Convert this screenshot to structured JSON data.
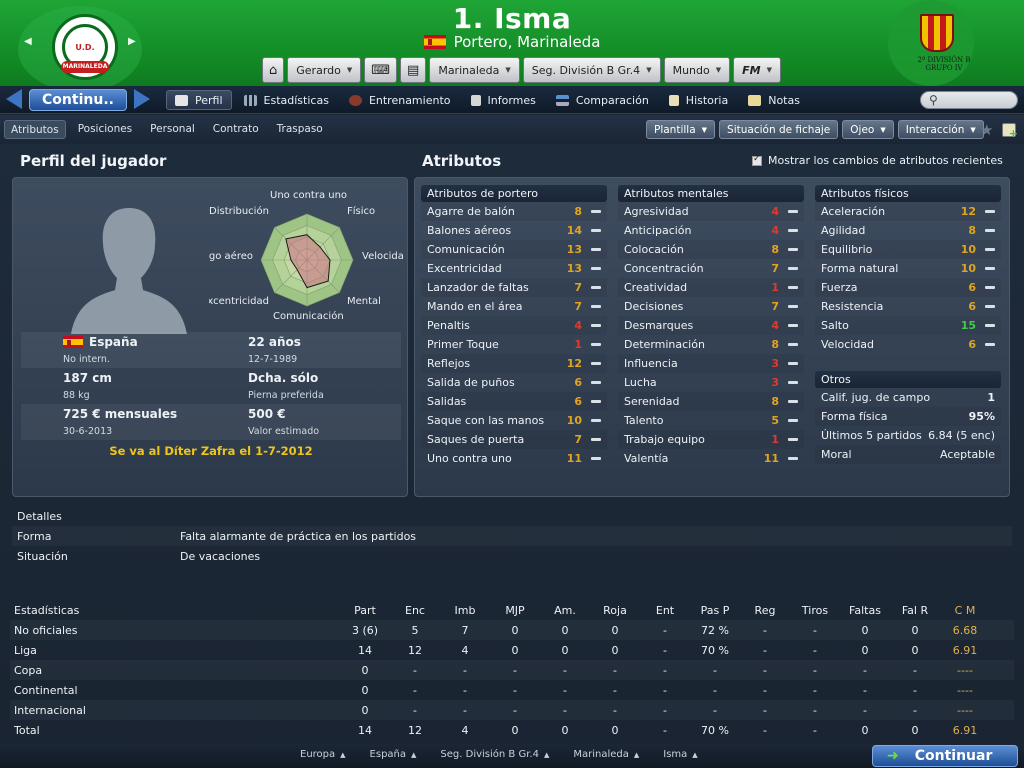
{
  "header": {
    "player_title": "1. Isma",
    "player_subtitle": "Portero, Marinaleda",
    "club_logo_text": "MARINALEDA",
    "club_logo_top": "U.D.",
    "league_logo_text": "2ª DIVISIÓN B GRUPO IV",
    "buttons": {
      "manager": "Gerardo",
      "club": "Marinaleda",
      "competition": "Seg. División B Gr.4",
      "world": "Mundo",
      "fm": "FM"
    }
  },
  "nav": {
    "continue_label": "Continu..",
    "tabs": [
      "Perfil",
      "Estadísticas",
      "Entrenamiento",
      "Informes",
      "Comparación",
      "Historia",
      "Notas"
    ],
    "active_tab": "Perfil"
  },
  "subnav": {
    "tabs": [
      "Atributos",
      "Posiciones",
      "Personal",
      "Contrato",
      "Traspaso"
    ],
    "active_tab": "Atributos",
    "buttons": {
      "plantilla": "Plantilla",
      "transfer_status": "Situación de fichaje",
      "scout": "Ojeo",
      "interaction": "Interacción"
    }
  },
  "profile": {
    "heading": "Perfil del jugador",
    "radar_labels": {
      "top": "Uno contra uno",
      "tl": "Distribución",
      "tr": "Físico",
      "l": "Juego aéreo",
      "r": "Velocidad",
      "bl": "Excentricidad",
      "br": "Mental",
      "bottom": "Comunicación"
    },
    "radar_values": [
      11,
      8,
      10,
      13,
      12,
      6,
      7,
      13
    ],
    "nationality": "España",
    "intl": "No intern.",
    "age": "22 años",
    "dob": "12-7-1989",
    "height": "187 cm",
    "weight": "88 kg",
    "foot": "Dcha. sólo",
    "foot_label": "Pierna preferida",
    "wage": "725 € mensuales",
    "contract_end": "30-6-2013",
    "value": "500 €",
    "value_label": "Valor estimado",
    "leaving_note": "Se va al Díter Zafra el 1-7-2012"
  },
  "attributes": {
    "heading": "Atributos",
    "show_changes_label": "Mostrar los cambios de atributos recientes",
    "goalkeeping": {
      "title": "Atributos de portero",
      "items": [
        {
          "name": "Agarre de balón",
          "value": "8",
          "color": "y"
        },
        {
          "name": "Balones aéreos",
          "value": "14",
          "color": "y"
        },
        {
          "name": "Comunicación",
          "value": "13",
          "color": "y"
        },
        {
          "name": "Excentricidad",
          "value": "13",
          "color": "y"
        },
        {
          "name": "Lanzador de faltas",
          "value": "7",
          "color": "y"
        },
        {
          "name": "Mando en el área",
          "value": "7",
          "color": "y"
        },
        {
          "name": "Penaltis",
          "value": "4",
          "color": "r"
        },
        {
          "name": "Primer Toque",
          "value": "1",
          "color": "r"
        },
        {
          "name": "Reflejos",
          "value": "12",
          "color": "y"
        },
        {
          "name": "Salida de puños",
          "value": "6",
          "color": "y"
        },
        {
          "name": "Salidas",
          "value": "6",
          "color": "y"
        },
        {
          "name": "Saque con las manos",
          "value": "10",
          "color": "y"
        },
        {
          "name": "Saques de puerta",
          "value": "7",
          "color": "y"
        },
        {
          "name": "Uno contra uno",
          "value": "11",
          "color": "y"
        }
      ]
    },
    "mental": {
      "title": "Atributos mentales",
      "items": [
        {
          "name": "Agresividad",
          "value": "4",
          "color": "r"
        },
        {
          "name": "Anticipación",
          "value": "4",
          "color": "r"
        },
        {
          "name": "Colocación",
          "value": "8",
          "color": "y"
        },
        {
          "name": "Concentración",
          "value": "7",
          "color": "y"
        },
        {
          "name": "Creatividad",
          "value": "1",
          "color": "r"
        },
        {
          "name": "Decisiones",
          "value": "7",
          "color": "y"
        },
        {
          "name": "Desmarques",
          "value": "4",
          "color": "r"
        },
        {
          "name": "Determinación",
          "value": "8",
          "color": "y"
        },
        {
          "name": "Influencia",
          "value": "3",
          "color": "r"
        },
        {
          "name": "Lucha",
          "value": "3",
          "color": "r"
        },
        {
          "name": "Serenidad",
          "value": "8",
          "color": "y"
        },
        {
          "name": "Talento",
          "value": "5",
          "color": "y"
        },
        {
          "name": "Trabajo equipo",
          "value": "1",
          "color": "r"
        },
        {
          "name": "Valentía",
          "value": "11",
          "color": "y"
        }
      ]
    },
    "physical": {
      "title": "Atributos físicos",
      "items": [
        {
          "name": "Aceleración",
          "value": "12",
          "color": "y"
        },
        {
          "name": "Agilidad",
          "value": "8",
          "color": "y"
        },
        {
          "name": "Equilibrio",
          "value": "10",
          "color": "y"
        },
        {
          "name": "Forma natural",
          "value": "10",
          "color": "y"
        },
        {
          "name": "Fuerza",
          "value": "6",
          "color": "y"
        },
        {
          "name": "Resistencia",
          "value": "6",
          "color": "y"
        },
        {
          "name": "Salto",
          "value": "15",
          "color": "g"
        },
        {
          "name": "Velocidad",
          "value": "6",
          "color": "y"
        }
      ]
    },
    "others": {
      "title": "Otros",
      "items": [
        {
          "name": "Calif. jug. de campo",
          "value": "1"
        },
        {
          "name": "Forma física",
          "value": "95%"
        },
        {
          "name": "Últimos 5 partidos",
          "value": "6.84 (5 enc)"
        },
        {
          "name": "Moral",
          "value": "Aceptable"
        }
      ]
    }
  },
  "details": {
    "title": "Detalles",
    "rows": [
      {
        "label": "Forma",
        "value": "Falta alarmante de práctica en los partidos"
      },
      {
        "label": "Situación",
        "value": "De vacaciones"
      }
    ]
  },
  "stats": {
    "title": "Estadísticas",
    "columns": [
      "Part",
      "Enc",
      "Imb",
      "MJP",
      "Am.",
      "Roja",
      "Ent",
      "Pas P",
      "Reg",
      "Tiros",
      "Faltas",
      "Fal R",
      "C M"
    ],
    "rows": [
      {
        "label": "No oficiales",
        "values": [
          "3 (6)",
          "5",
          "7",
          "0",
          "0",
          "0",
          "-",
          "72 %",
          "-",
          "-",
          "0",
          "0",
          "6.68"
        ]
      },
      {
        "label": "Liga",
        "values": [
          "14",
          "12",
          "4",
          "0",
          "0",
          "0",
          "-",
          "70 %",
          "-",
          "-",
          "0",
          "0",
          "6.91"
        ]
      },
      {
        "label": "Copa",
        "values": [
          "0",
          "-",
          "-",
          "-",
          "-",
          "-",
          "-",
          "-",
          "-",
          "-",
          "-",
          "-",
          "----"
        ]
      },
      {
        "label": "Continental",
        "values": [
          "0",
          "-",
          "-",
          "-",
          "-",
          "-",
          "-",
          "-",
          "-",
          "-",
          "-",
          "-",
          "----"
        ]
      },
      {
        "label": "Internacional",
        "values": [
          "0",
          "-",
          "-",
          "-",
          "-",
          "-",
          "-",
          "-",
          "-",
          "-",
          "-",
          "-",
          "----"
        ]
      },
      {
        "label": "Total",
        "values": [
          "14",
          "12",
          "4",
          "0",
          "0",
          "0",
          "-",
          "70 %",
          "-",
          "-",
          "0",
          "0",
          "6.91"
        ]
      }
    ]
  },
  "footer": {
    "crumbs": [
      "Europa",
      "España",
      "Seg. División B Gr.4",
      "Marinaleda",
      "Isma"
    ],
    "continue_label": "Continuar"
  },
  "colors": {
    "header_green": "#1fa536",
    "attr_yellow": "#e0a520",
    "attr_red": "#e03a2f",
    "attr_green": "#44c84a",
    "leaving_note": "#f0c419",
    "continue_blue": "#1d4e97"
  }
}
